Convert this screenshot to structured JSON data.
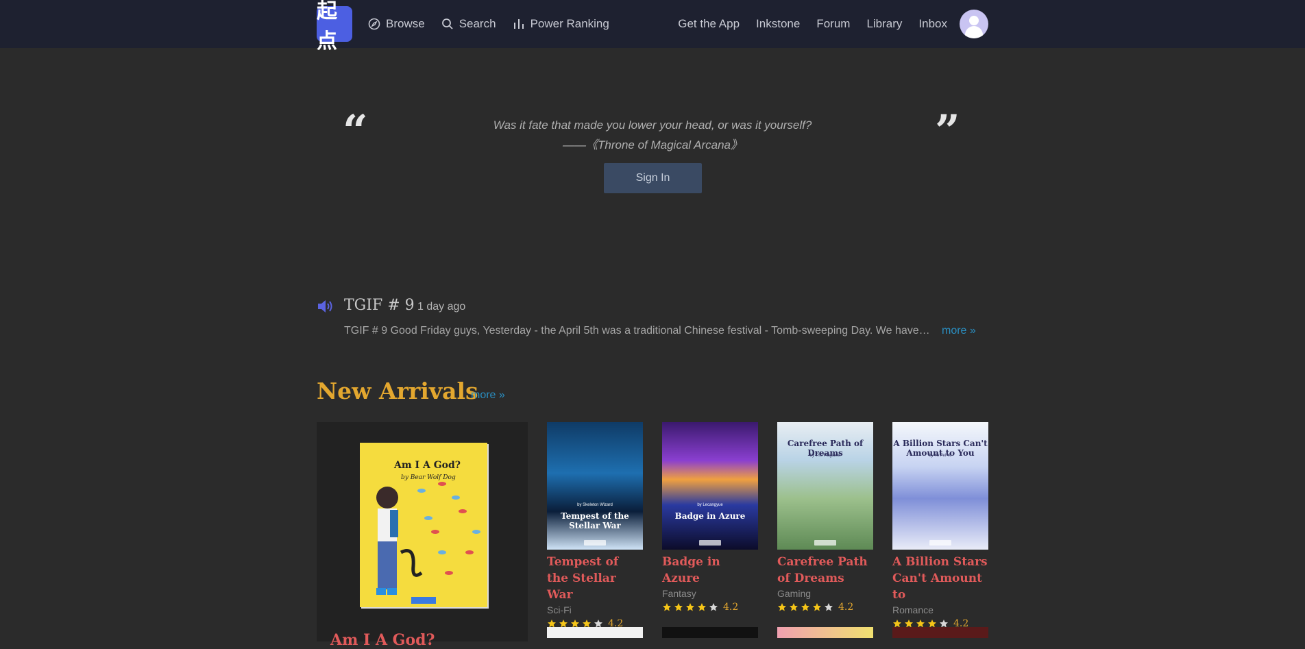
{
  "nav": {
    "logo_text": "起点",
    "left": [
      {
        "label": "Browse",
        "icon": "compass-icon"
      },
      {
        "label": "Search",
        "icon": "search-icon"
      },
      {
        "label": "Power Ranking",
        "icon": "bar-chart-icon"
      }
    ],
    "right": [
      "Get the App",
      "Inkstone",
      "Forum",
      "Library",
      "Inbox"
    ]
  },
  "hero": {
    "quote_line1": "Was it fate that made you lower your head, or was it yourself?",
    "quote_line2": "——《Throne of Magical Arcana》",
    "open_mark": "“",
    "close_mark": "”",
    "signin_label": "Sign In"
  },
  "announcement": {
    "title": "TGIF # 9",
    "time": "1 day ago",
    "text": "TGIF # 9 Good Friday guys, Yesterday - the April 5th was a traditional Chinese festival - Tomb-sweeping Day. We have a lot of exciting news to share with you",
    "more": "more »"
  },
  "new_arrivals": {
    "title": "New Arrivals",
    "more": "more »",
    "featured": {
      "cover_title": "Am I A God?",
      "cover_author": "by Bear Wolf Dog",
      "title": "Am I A God?"
    },
    "books": [
      {
        "title": "Tempest of the Stellar War",
        "genre": "Sci-Fi",
        "rating": "4.2",
        "stars": 4,
        "cover_title": "Tempest of the Stellar War",
        "cover_author": "by Skeleton Wizard",
        "bg": "linear-gradient(180deg,#0f3b66 0%,#1e6fb0 40%,#0a1e3a 70%,#cfe3f6 100%)"
      },
      {
        "title": "Badge in Azure",
        "genre": "Fantasy",
        "rating": "4.2",
        "stars": 4,
        "cover_title": "Badge in Azure",
        "cover_author": "by Lecangyue",
        "bg": "linear-gradient(180deg,#3b1a6e 0%,#8a3fd0 30%,#f0a040 45%,#2a3aa0 65%,#0c0c2a 100%)"
      },
      {
        "title": "Carefree Path of Dreams",
        "genre": "Gaming",
        "rating": "4.2",
        "stars": 4,
        "cover_title": "Carefree Path of Dreams",
        "cover_author": "by The Plagiarist",
        "bg": "linear-gradient(180deg,#e8eef3 0%,#b9d3e6 30%,#9cc08c 60%,#5e8a55 100%)"
      },
      {
        "title": "A Billion Stars Can't Amount to",
        "genre": "Romance",
        "rating": "4.2",
        "stars": 4,
        "cover_title": "A Billion Stars Can't Amount to You",
        "cover_author": "by Ye Fei Ye",
        "bg": "linear-gradient(180deg,#f4f7fb 0%,#c7d3f2 35%,#7f8fd8 60%,#e9ecf8 100%)"
      }
    ]
  },
  "colors": {
    "accent": "#e3a72f",
    "link": "#2a8fc2",
    "title_red": "#e05a5a",
    "logo": "#4c5fe2"
  }
}
